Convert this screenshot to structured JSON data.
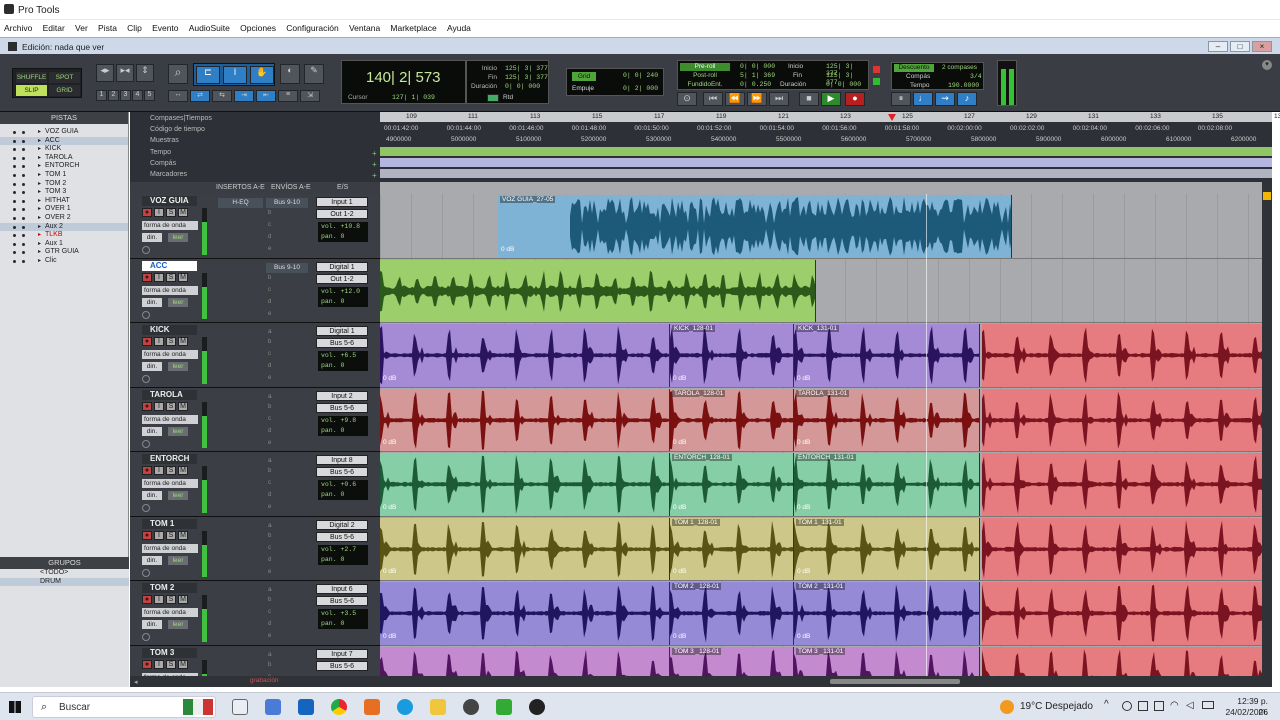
{
  "app_title": "Pro Tools",
  "menu": [
    "Archivo",
    "Editar",
    "Ver",
    "Pista",
    "Clip",
    "Evento",
    "AudioSuite",
    "Opciones",
    "Configuración",
    "Ventana",
    "Marketplace",
    "Ayuda"
  ],
  "window_title": "Edición: nada que ver",
  "toolbar": {
    "mode_shuffle": "SHUFFLE",
    "mode_spot": "SPOT",
    "mode_slip": "SLIP",
    "mode_grid": "GRID",
    "zoom_presets": [
      "1",
      "2",
      "3",
      "4",
      "5"
    ],
    "main_counter": "140| 2| 573",
    "cursor_label": "Cursor",
    "cursor_value": "127| 1| 039",
    "sel_start_label": "Inicio",
    "sel_end_label": "Fin",
    "sel_len_label": "Duración",
    "sel_start": "125| 3| 377",
    "sel_end": "125| 3| 377",
    "sel_len": "0| 0| 000",
    "grid_label": "Grid",
    "grid_value": "0| 0| 240",
    "nudge_label": "Empuje",
    "nudge_value": "0| 2| 000",
    "rtd_label": "Rtd",
    "preroll_label": "Pre-roll",
    "postroll_label": "Post-roll",
    "fadein_label": "FundidoEnt.",
    "preroll": "0| 0| 000",
    "postroll": "5| 1| 369",
    "fadein": "0| 0.250",
    "start2_label": "Inicio",
    "end2_label": "Fin",
    "len2_label": "Duración",
    "start2": "125| 3| 377",
    "end2": "125| 3| 377",
    "len2": "0| 0| 000",
    "countoff_label": "Descuento",
    "countoff_value": "2 compases",
    "meter_label": "Compás",
    "meter_value": "3/4",
    "tempo_label": "Tempo",
    "tempo_value": "190.0000"
  },
  "left_panel": {
    "tracks_header": "PISTAS",
    "tracks": [
      {
        "name": "VOZ GUIA",
        "selected": false,
        "red": false
      },
      {
        "name": "ACC",
        "selected": true,
        "red": false
      },
      {
        "name": "KICK",
        "selected": false,
        "red": false
      },
      {
        "name": "TAROLA",
        "selected": false,
        "red": false
      },
      {
        "name": "ENTORCH",
        "selected": false,
        "red": false
      },
      {
        "name": "TOM 1",
        "selected": false,
        "red": false
      },
      {
        "name": "TOM 2",
        "selected": false,
        "red": false
      },
      {
        "name": "TOM 3",
        "selected": false,
        "red": false
      },
      {
        "name": "HITHAT",
        "selected": false,
        "red": false
      },
      {
        "name": "OVER 1",
        "selected": false,
        "red": false
      },
      {
        "name": "OVER 2",
        "selected": false,
        "red": false
      },
      {
        "name": "Aux 2",
        "selected": true,
        "red": false
      },
      {
        "name": "TLKB",
        "selected": false,
        "red": true
      },
      {
        "name": "Aux 1",
        "selected": false,
        "red": false
      },
      {
        "name": "GTR GUIA",
        "selected": false,
        "red": false
      },
      {
        "name": "Clic",
        "selected": false,
        "red": false
      }
    ],
    "groups_header": "GRUPOS",
    "groups": [
      "<TODO>",
      "DRUM"
    ]
  },
  "rulers": {
    "bars_label": "Compases|Tiempos",
    "timecode_label": "Código de tiempo",
    "samples_label": "Muestras",
    "tempo_label": "Tempo",
    "meter_label": "Compás",
    "markers_label": "Marcadores",
    "bars": [
      "109",
      "111",
      "113",
      "115",
      "117",
      "119",
      "121",
      "123",
      "125",
      "127",
      "129",
      "131",
      "133",
      "135",
      "137"
    ],
    "timecodes": [
      "00:01:42:00",
      "00:01:44:00",
      "00:01:46:00",
      "00:01:48:00",
      "00:01:50:00",
      "00:01:52:00",
      "00:01:54:00",
      "00:01:56:00",
      "00:01:58:00",
      "00:02:00:00",
      "00:02:02:00",
      "00:02:04:00",
      "00:02:06:00",
      "00:02:08:00"
    ],
    "samples": [
      "4900000",
      "5000000",
      "5100000",
      "5200000",
      "5300000",
      "5400000",
      "5500000",
      "5600000",
      "5700000",
      "5800000",
      "5900000",
      "6000000",
      "6100000",
      "6200000"
    ]
  },
  "track_header": {
    "inserts": "INSERTOS A-E",
    "sends": "ENVÍOS A-E",
    "io": "E/S"
  },
  "track_labels": {
    "rec": "●",
    "input": "I",
    "solo": "S",
    "mute": "M",
    "waveform": "forma de onda",
    "dyn": "din.",
    "read": "leer",
    "vol": "vol.",
    "pan": "pan.",
    "send_slots": [
      "b",
      "c",
      "d",
      "e"
    ],
    "db_label": "0 dB"
  },
  "tracks": [
    {
      "name": "VOZ GUIA",
      "insert": "H-EQ",
      "send": "Bus 9-10",
      "input": "Input 1",
      "output": "Out 1-2",
      "vol": "+10.8",
      "pan": "0",
      "color": "#7fb3d5",
      "wave": "#1d5a7a"
    },
    {
      "name": "ACC",
      "insert": "",
      "send": "Bus 9-10",
      "input": "Digital 1",
      "output": "Out 1-2",
      "vol": "+12.0",
      "pan": "0",
      "color": "#9ccf6b",
      "wave": "#2c5a1a"
    },
    {
      "name": "KICK",
      "insert": "",
      "send": "",
      "input": "Digital 1",
      "output": "Bus 5-6",
      "vol": "+6.5",
      "pan": "0",
      "color": "#a58ad6",
      "wave": "#2a1460"
    },
    {
      "name": "TAROLA",
      "insert": "",
      "send": "",
      "input": "Input 2",
      "output": "Bus 5-6",
      "vol": "+9.8",
      "pan": "0",
      "color": "#d49898",
      "wave": "#7a1010"
    },
    {
      "name": "ENTORCH",
      "insert": "",
      "send": "",
      "input": "Input 8",
      "output": "Bus 5-6",
      "vol": "+0.6",
      "pan": "0",
      "color": "#86cfa6",
      "wave": "#1d5a36"
    },
    {
      "name": "TOM 1",
      "insert": "",
      "send": "",
      "input": "Digital 2",
      "output": "Bus 5-6",
      "vol": "+2.7",
      "pan": "0",
      "color": "#cdc78a",
      "wave": "#5a5414"
    },
    {
      "name": "TOM 2",
      "insert": "",
      "send": "",
      "input": "Input 6",
      "output": "Bus 5-6",
      "vol": "+3.5",
      "pan": "0",
      "color": "#958ad6",
      "wave": "#201660"
    },
    {
      "name": "TOM 3",
      "insert": "",
      "send": "",
      "input": "Input 7",
      "output": "Bus 5-6",
      "vol": "",
      "pan": "",
      "color": "#c48ad0",
      "wave": "#501460"
    }
  ],
  "clip_names": {
    "voz": "VOZ GUIA_27-05",
    "kick1": "KICK_128-01",
    "kick2": "KICK_131-01",
    "tarola1": "TAROLA_128-01",
    "tarola2": "TAROLA_131-01",
    "entorch1": "ENTORCH_128-01",
    "entorch2": "ENTORCH_131-01",
    "tom1a": "TOM 1_128-01",
    "tom1b": "TOM 1_131-01",
    "tom2a": "TOM 2 _128-01",
    "tom2b": "TOM 2 _131-01",
    "tom3a": "TOM 3 _128-01",
    "tom3b": "TOM 3 _131-01"
  },
  "bottom_status": "grabación",
  "taskbar": {
    "search_placeholder": "Buscar",
    "weather": "19°C  Despejado",
    "time": "12:39 p. m.",
    "date": "24/02/2026"
  },
  "colors": {
    "accent_green": "#9fd67e",
    "mixer_bg": "#3b3e44",
    "red_clip": "#e77c80"
  }
}
